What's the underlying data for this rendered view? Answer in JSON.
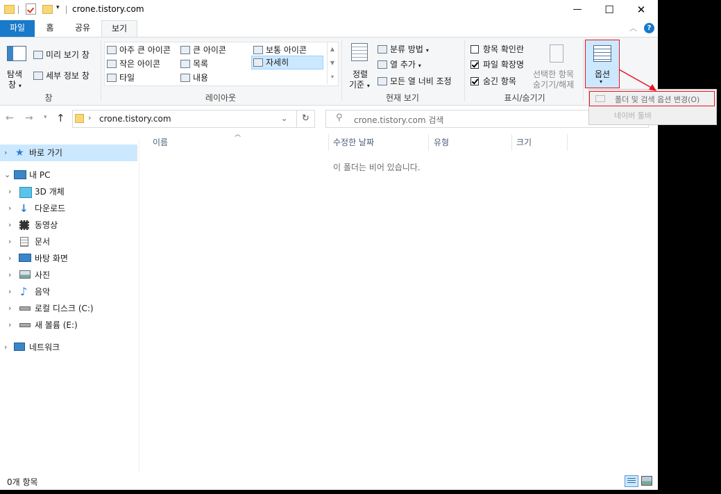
{
  "window": {
    "title": "crone.tistory.com",
    "minimize": "—",
    "maximize": "☐",
    "close": "✕"
  },
  "tabs": {
    "file": "파일",
    "home": "홈",
    "share": "공유",
    "view": "보기"
  },
  "ribbon": {
    "pane": {
      "nav_pane_line1": "탐색",
      "nav_pane_line2": "창",
      "preview": "미리 보기 창",
      "details": "세부 정보 창",
      "group_label": "창"
    },
    "layout": {
      "items": [
        "아주 큰 아이콘",
        "큰 아이콘",
        "보통 아이콘",
        "작은 아이콘",
        "목록",
        "자세히",
        "타일",
        "내용"
      ],
      "selected": "자세히",
      "group_label": "레이아웃"
    },
    "current_view": {
      "sort_line1": "정렬",
      "sort_line2": "기준",
      "group_by": "분류 방법",
      "add_column": "열 추가",
      "size_all_columns": "모든 열 너비 조정",
      "group_label": "현재 보기"
    },
    "show_hide": {
      "item_checkboxes": "항목 확인란",
      "item_checkboxes_checked": false,
      "file_extensions": "파일 확장명",
      "file_extensions_checked": true,
      "hidden_items": "숨긴 항목",
      "hidden_items_checked": true,
      "hide_selected_line1": "선택한 항목",
      "hide_selected_line2": "숨기기/해제",
      "group_label": "표시/숨기기"
    },
    "options": {
      "label": "옵션"
    }
  },
  "address_bar": {
    "path": "crone.tistory.com"
  },
  "search": {
    "placeholder": "crone.tistory.com 검색"
  },
  "nav_pane": {
    "quick_access": "바로 가기",
    "this_pc": "내 PC",
    "items": [
      "3D 개체",
      "다운로드",
      "동영상",
      "문서",
      "바탕 화면",
      "사진",
      "음악",
      "로컬 디스크 (C:)",
      "새 볼륨 (E:)"
    ],
    "network": "네트워크"
  },
  "columns": {
    "name": "이름",
    "date": "수정한 날짜",
    "type": "유형",
    "size": "크기"
  },
  "empty_message": "이 폴더는 비어 있습니다.",
  "status": {
    "count": "0개 항목"
  },
  "options_menu": {
    "change_options": "폴더 및 검색 옵션 변경(O)",
    "second": "네이버 툴바"
  },
  "colors": {
    "file_tab": "#1979ca",
    "selection": "#cce8ff",
    "highlight_border": "#e81123",
    "help": "#1979ca"
  }
}
